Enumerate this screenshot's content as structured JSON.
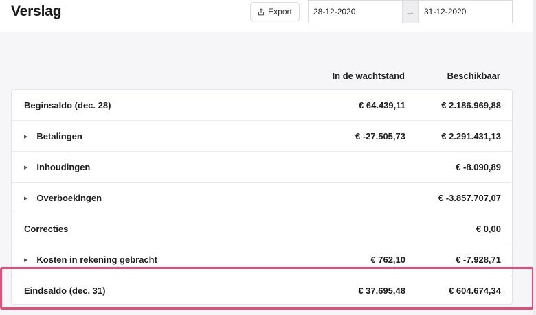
{
  "header": {
    "title": "Verslag",
    "export_label": "Export",
    "export_icon": "share-icon",
    "date_from": "28-12-2020",
    "date_to": "31-12-2020",
    "date_separator": "→"
  },
  "table": {
    "columns": [
      "In de wachtstand",
      "Beschikbaar"
    ],
    "rows": [
      {
        "label": "Beginsaldo (dec. 28)",
        "expandable": false,
        "waiting": "€ 64.439,11",
        "available": "€ 2.186.969,88"
      },
      {
        "label": "Betalingen",
        "expandable": true,
        "waiting": "€ -27.505,73",
        "available": "€ 2.291.431,13"
      },
      {
        "label": "Inhoudingen",
        "expandable": true,
        "waiting": "",
        "available": "€ -8.090,89"
      },
      {
        "label": "Overboekingen",
        "expandable": true,
        "waiting": "",
        "available": "€ -3.857.707,07"
      },
      {
        "label": "Correcties",
        "expandable": false,
        "waiting": "",
        "available": "€ 0,00"
      },
      {
        "label": "Kosten in rekening gebracht",
        "expandable": true,
        "waiting": "€ 762,10",
        "available": "€ -7.928,71"
      }
    ],
    "final": {
      "label": "Eindsaldo (dec. 31)",
      "waiting": "€ 37.695,48",
      "available": "€ 604.674,34"
    }
  },
  "colors": {
    "highlight": "#e64b79",
    "background": "#f6f6f8"
  }
}
